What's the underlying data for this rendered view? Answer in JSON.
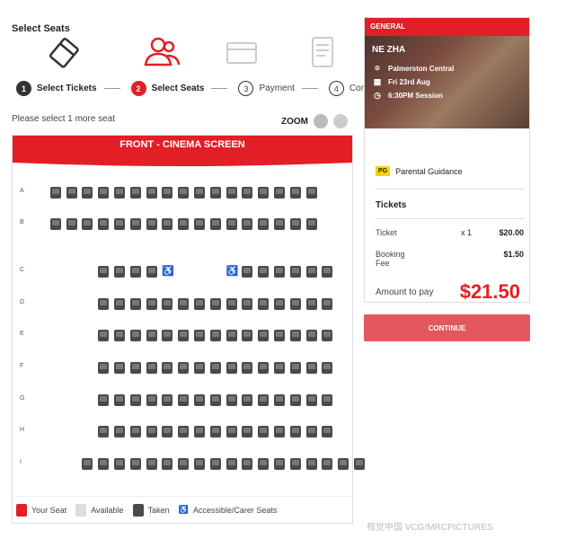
{
  "page": {
    "title": "Select Seats",
    "hint": "Please select 1 more seat",
    "zoom_label": "ZOOM",
    "watermark": "视觉中国 VCG/MRCPICTURES"
  },
  "steps": [
    {
      "num": "1",
      "label": "Select Tickets",
      "state": "done"
    },
    {
      "num": "2",
      "label": "Select Seats",
      "state": "active"
    },
    {
      "num": "3",
      "label": "Payment",
      "state": "future"
    },
    {
      "num": "4",
      "label": "Confirmation",
      "state": "future"
    }
  ],
  "step_icons": [
    "ticket-icon",
    "users-icon",
    "card-icon",
    "document-icon"
  ],
  "screen_label": "FRONT - CINEMA SCREEN",
  "rows": [
    {
      "letter": "A",
      "seats": 17,
      "start": 1,
      "gap_after": null
    },
    {
      "letter": "B",
      "seats": 17,
      "start": 1,
      "gap_after": null
    },
    {
      "letter": "C",
      "seats": 12,
      "start": 4,
      "gap_after": 4,
      "wheelchair": true
    },
    {
      "letter": "D",
      "seats": 15,
      "start": 4
    },
    {
      "letter": "E",
      "seats": 15,
      "start": 4
    },
    {
      "letter": "F",
      "seats": 15,
      "start": 4
    },
    {
      "letter": "G",
      "seats": 15,
      "start": 4
    },
    {
      "letter": "H",
      "seats": 15,
      "start": 4
    },
    {
      "letter": "I",
      "seats": 18,
      "start": 3
    }
  ],
  "legend": {
    "your_seat": "Your Seat",
    "available": "Available",
    "taken": "Taken",
    "accessible": "Accessible/Carer Seats"
  },
  "summary": {
    "header": "GENERAL",
    "movie": "NE ZHA",
    "cinema": "Palmerston Central",
    "date": "Fri 23rd Aug",
    "session": "6:30PM Session",
    "rating_badge": "PG",
    "rating": "Parental Guidance",
    "tickets_title": "Tickets",
    "ticket_label": "Ticket",
    "ticket_qty": "x 1",
    "ticket_price": "$20.00",
    "booking_fee_label": "Booking Fee",
    "booking_fee": "$1.50",
    "amount_label": "Amount to pay",
    "amount": "$21.50"
  },
  "continue_label": "CONTINUE",
  "colors": {
    "accent": "#e21f26",
    "taken": "#4a4a4a",
    "continue": "#e2585e"
  }
}
